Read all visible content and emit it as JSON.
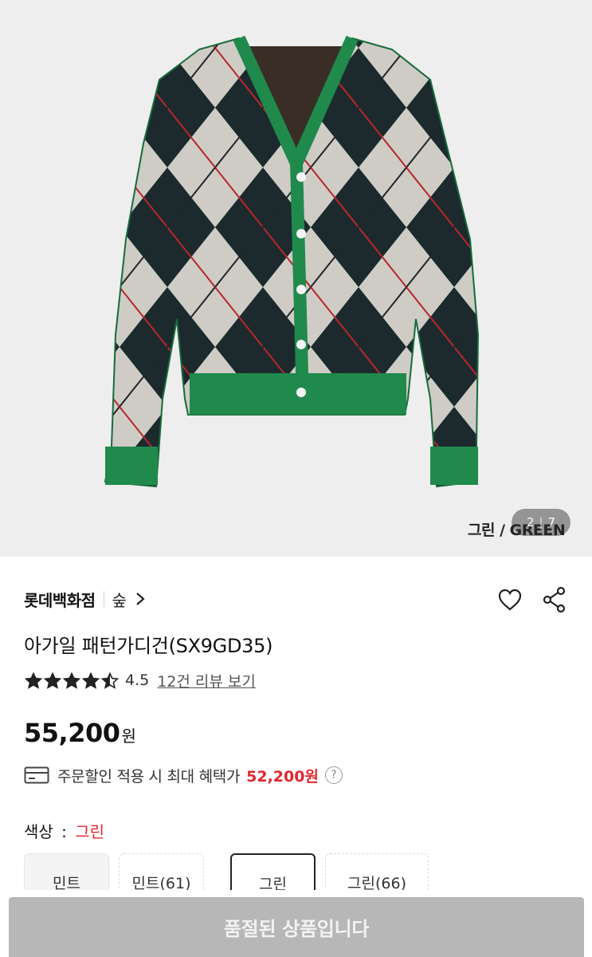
{
  "gallery": {
    "color_caption": "그린 / GREEN",
    "current_page": "2",
    "total_pages": "7"
  },
  "brand": {
    "name": "롯데백화점",
    "shop": "숲"
  },
  "icons": {
    "chevron": "chevron-right-icon",
    "wishlist": "heart-icon",
    "share": "share-icon",
    "coupon": "card-icon",
    "help": "question-icon"
  },
  "product": {
    "title": "아가일 패턴가디건(SX9GD35)",
    "rating": 4.5,
    "rating_label": "4.5",
    "review_link": "12건 리뷰 보기",
    "price": "55,200",
    "currency": "원"
  },
  "benefit": {
    "text": "주문할인 적용 시 최대 혜택가",
    "price": "52,200원",
    "help": "?"
  },
  "color_option": {
    "label": "색상",
    "separator": ":",
    "selected": "그린",
    "options": [
      {
        "label": "민트",
        "state": "sold"
      },
      {
        "label": "민트(61)",
        "state": "dashed"
      },
      {
        "label": "그린",
        "state": "active"
      },
      {
        "label": "그린(66)",
        "state": "dashed"
      }
    ]
  },
  "cta": {
    "label": "품절된 상품입니다"
  },
  "colors": {
    "accent_red": "#e0272e",
    "cta_disabled": "#b7b7b7",
    "sweater_green": "#1f8a4c",
    "diamond_navy": "#1c2a2e",
    "diamond_gray": "#cfccc6"
  }
}
